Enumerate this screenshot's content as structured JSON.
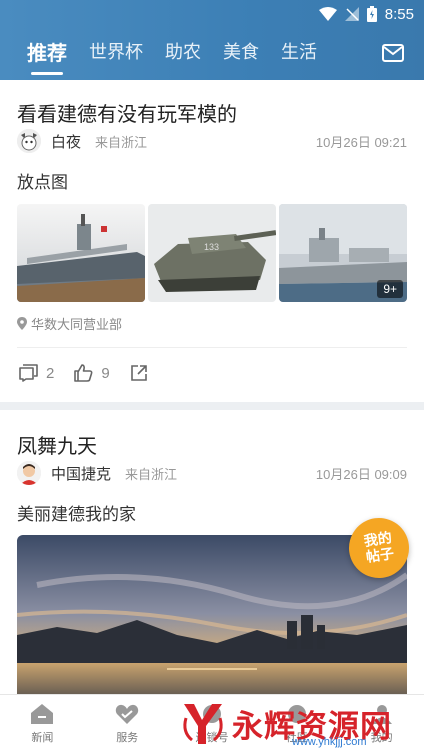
{
  "statusbar": {
    "time": "8:55"
  },
  "tabs": [
    {
      "label": "推荐",
      "active": true
    },
    {
      "label": "世界杯"
    },
    {
      "label": "助农"
    },
    {
      "label": "美食"
    },
    {
      "label": "生活"
    }
  ],
  "posts": [
    {
      "title": "看看建德有没有玩军模的",
      "author": "白夜",
      "from": "来自浙江",
      "time": "10月26日 09:21",
      "body": "放点图",
      "more_images": "9+",
      "location": "华数大同营业部",
      "comments": "2",
      "likes": "9"
    },
    {
      "title": "凤舞九天",
      "author": "中国捷克",
      "from": "来自浙江",
      "time": "10月26日 09:09",
      "body": "美丽建德我的家"
    }
  ],
  "fab": {
    "line1": "我的",
    "line2": "帖子"
  },
  "bottom_nav": [
    {
      "label": "新闻"
    },
    {
      "label": "服务"
    },
    {
      "label": "连锁号"
    },
    {
      "label": "社区"
    },
    {
      "label": "我的"
    }
  ],
  "watermark": {
    "text": "永辉资源网",
    "url": "www.yhkjjj.com"
  },
  "colors": {
    "header": "#3c7fb5",
    "fab": "#f5a623",
    "watermark": "#d6232a"
  }
}
